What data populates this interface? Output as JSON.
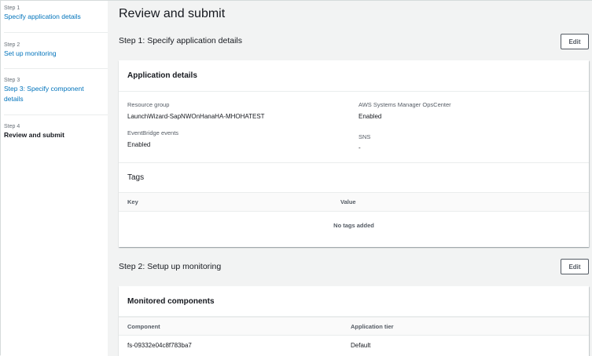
{
  "sidebar": {
    "steps": [
      {
        "number": "Step 1",
        "label": "Specify application details"
      },
      {
        "number": "Step 2",
        "label": "Set up monitoring"
      },
      {
        "number": "Step 3",
        "label_line1": "Step 3: Specify component",
        "label_line2": "details"
      },
      {
        "number": "Step 4",
        "label": "Review and submit"
      }
    ]
  },
  "main": {
    "page_title": "Review and submit",
    "step1": {
      "title": "Step 1: Specify application details",
      "edit_label": "Edit",
      "application_details": {
        "header": "Application details",
        "resource_group_label": "Resource group",
        "resource_group_value": "LaunchWizard-SapNWOnHanaHA-MHOHATEST",
        "opscenter_label": "AWS Systems Manager OpsCenter",
        "opscenter_value": "Enabled",
        "eventbridge_label": "EventBridge events",
        "eventbridge_value": "Enabled",
        "sns_label": "SNS",
        "sns_value": "-"
      },
      "tags": {
        "header": "Tags",
        "columns": [
          "Key",
          "Value"
        ],
        "empty_message": "No tags added"
      }
    },
    "step2": {
      "title": "Step 2: Setup up monitoring",
      "edit_label": "Edit",
      "monitored_components": {
        "header": "Monitored components",
        "columns": [
          "Component",
          "Application tier"
        ],
        "rows": [
          {
            "component": "fs-09332e04c8f783ba7",
            "tier": "Default"
          }
        ]
      }
    }
  },
  "colors": {
    "link": "#0073bb",
    "text": "#16191f",
    "muted": "#545b64",
    "background": "#f2f3f3"
  }
}
